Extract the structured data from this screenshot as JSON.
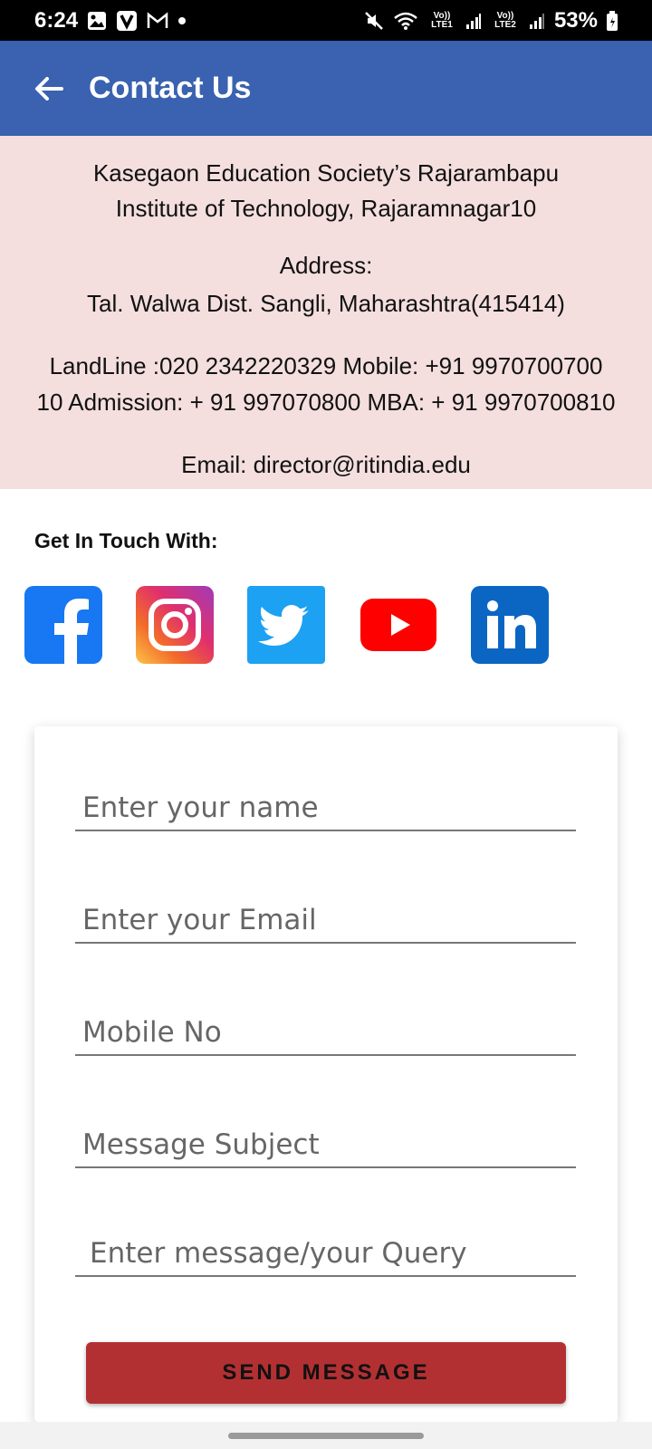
{
  "status_bar": {
    "time": "6:24",
    "left_icons": [
      "gallery-icon",
      "v-app-icon",
      "gmail-icon",
      "dot-icon"
    ],
    "right_icons": [
      "mute-icon",
      "wifi-icon",
      "signal-lte1-icon",
      "signal-lte2-icon",
      "battery-icon"
    ],
    "lte1": "Vo)) LTE1",
    "lte2": "Vo)) LTE2",
    "battery": "53%"
  },
  "app_bar": {
    "title": "Contact Us",
    "back_icon": "arrow-left-icon",
    "color": "#3a62b0"
  },
  "info": {
    "org_line1": "Kasegaon Education Society’s  Rajarambapu",
    "org_line2": "Institute of Technology, Rajaramnagar10",
    "address_heading": "Address:",
    "address": "Tal. Walwa Dist. Sangli, Maharashtra(415414)",
    "phones_line1": "LandLine :020 2342220329 Mobile: +91 9970700700",
    "phones_line2": "10 Admission: + 91 997070800 MBA: + 91 9970700810",
    "email": "Email: director@ritindia.edu",
    "background": "#f4dede"
  },
  "social": {
    "heading": "Get In Touch With:",
    "items": [
      "facebook-icon",
      "instagram-icon",
      "twitter-icon",
      "youtube-icon",
      "linkedin-icon"
    ]
  },
  "form": {
    "name_placeholder": "Enter your name",
    "email_placeholder": "Enter your Email",
    "mobile_placeholder": "Mobile No",
    "subject_placeholder": "Message Subject",
    "message_placeholder": "Enter message/your Query",
    "send_label": "SEND MESSAGE",
    "send_color": "#b33032"
  }
}
